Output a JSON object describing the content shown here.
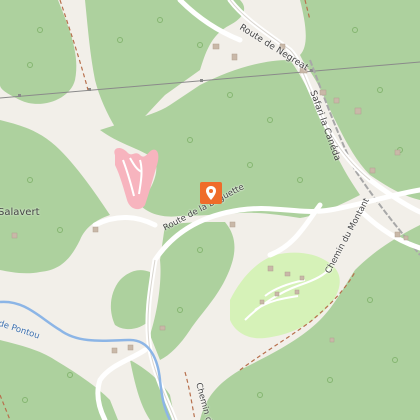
{
  "map": {
    "labels": {
      "road_negreat": "Route de Negreat",
      "road_buguette": "Route de la Buguette",
      "road_montant": "Chemin du Montant",
      "road_chemin_de": "Chemin de",
      "place_salavert": "Salavert",
      "place_safari": "Safari la Canéda",
      "water_pontou": "Ruisseau de Pontou"
    },
    "marker": {
      "icon": "map-pin-icon",
      "color": "#ef6c2a"
    },
    "colors": {
      "forest": "#add19e",
      "background": "#f2efe9",
      "campsite": "#d6f2b8",
      "track": "#f7b4be",
      "water": "#8cb5e6",
      "powerline": "#8a8a8a",
      "path": "#b7704d"
    }
  }
}
